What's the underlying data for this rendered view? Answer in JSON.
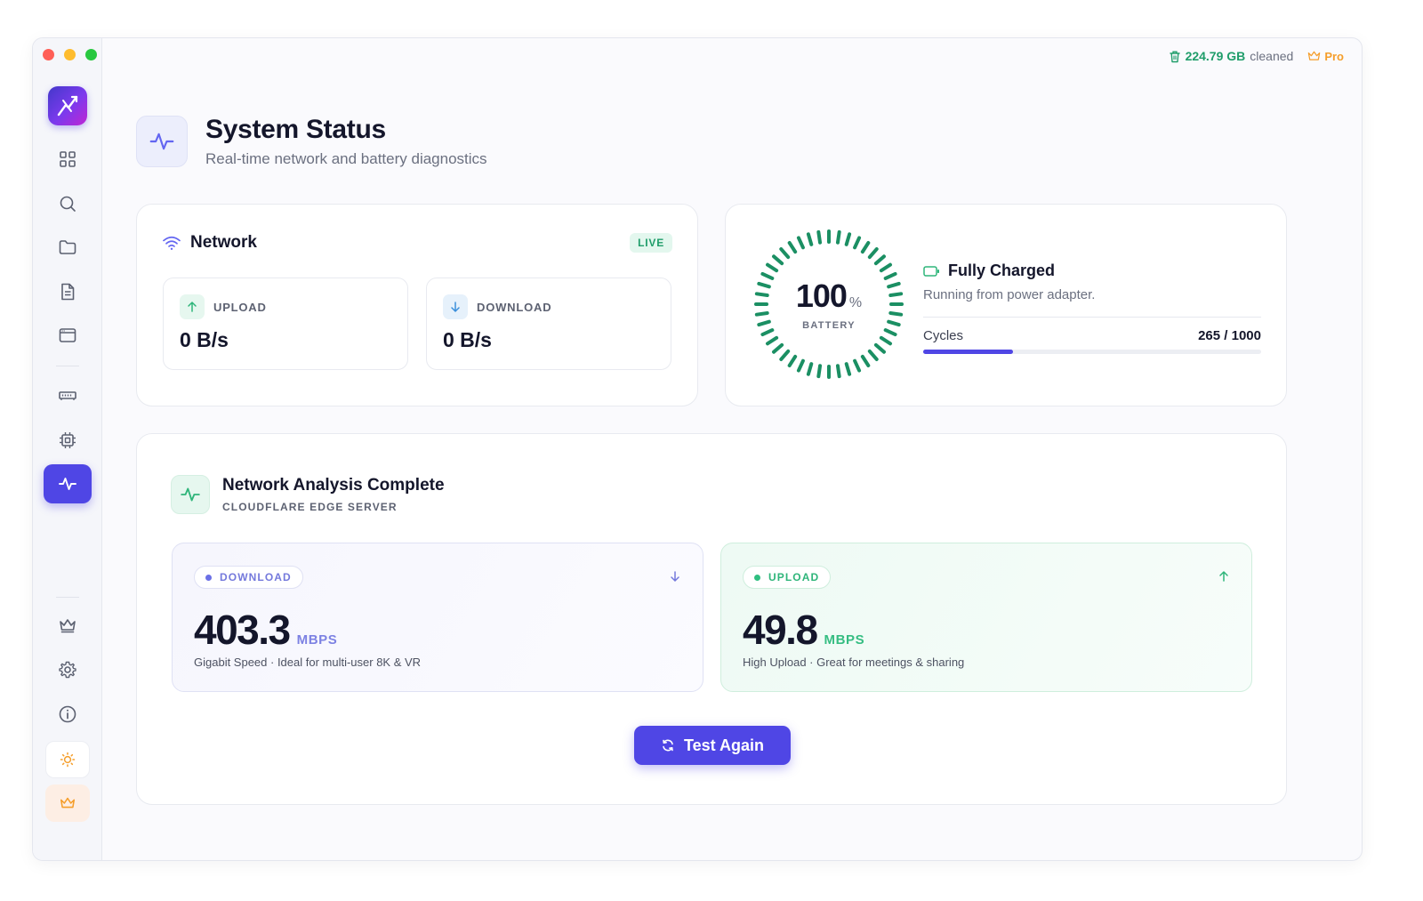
{
  "topbar": {
    "cleaned_amount": "224.79 GB",
    "cleaned_label": "cleaned",
    "pro_label": "Pro"
  },
  "sidebar": {
    "items": [
      {
        "name": "dashboard",
        "icon": "grid-icon"
      },
      {
        "name": "search",
        "icon": "search-icon"
      },
      {
        "name": "files",
        "icon": "folder-icon"
      },
      {
        "name": "documents",
        "icon": "document-icon"
      },
      {
        "name": "apps",
        "icon": "window-icon"
      },
      {
        "name": "memory",
        "icon": "memory-icon"
      },
      {
        "name": "cpu",
        "icon": "cpu-icon"
      },
      {
        "name": "system-status",
        "icon": "activity-icon",
        "active": true
      },
      {
        "name": "premium",
        "icon": "crown-icon"
      },
      {
        "name": "settings",
        "icon": "gear-icon"
      },
      {
        "name": "about",
        "icon": "info-icon"
      }
    ]
  },
  "header": {
    "title": "System Status",
    "subtitle": "Real-time network and battery diagnostics"
  },
  "network": {
    "title": "Network",
    "badge": "LIVE",
    "upload_label": "UPLOAD",
    "upload_value": "0 B/s",
    "download_label": "DOWNLOAD",
    "download_value": "0 B/s"
  },
  "battery": {
    "percent": "100",
    "percent_unit": "%",
    "gauge_label": "BATTERY",
    "level": 1.0,
    "status": "Fully Charged",
    "description": "Running from power adapter.",
    "cycles_label": "Cycles",
    "cycles_value": "265 / 1000",
    "cycles_fraction": 0.265
  },
  "analysis": {
    "title": "Network Analysis Complete",
    "subtitle": "CLOUDFLARE EDGE SERVER",
    "download": {
      "label": "DOWNLOAD",
      "value": "403.3",
      "unit": "MBPS",
      "description": "Gigabit Speed · Ideal for multi-user 8K & VR"
    },
    "upload": {
      "label": "UPLOAD",
      "value": "49.8",
      "unit": "MBPS",
      "description": "High Upload · Great for meetings & sharing"
    },
    "button_label": "Test Again"
  },
  "colors": {
    "accent": "#4f46e5",
    "success": "#1f9d6a",
    "gauge": "#1b8f63",
    "pro": "#f59e2b"
  }
}
